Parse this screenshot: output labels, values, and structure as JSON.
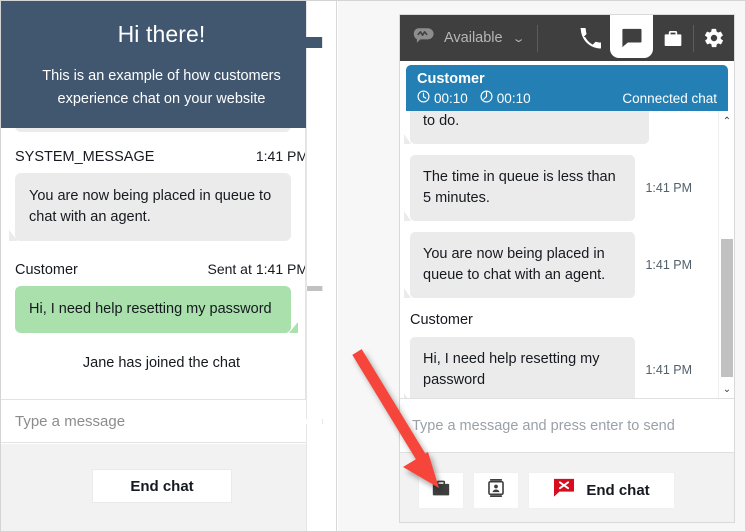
{
  "customer_widget": {
    "header": {
      "title": "Hi there!",
      "subtitle": "This is an example of how customers experience chat on your website"
    },
    "messages": [
      {
        "author": "SYSTEM_MESSAGE",
        "time": "1:41 PM",
        "sent_prefix": "",
        "text": "You are now being placed in queue to chat with an agent.",
        "kind": "system"
      },
      {
        "author": "Customer",
        "time": "1:41 PM",
        "sent_prefix": "Sent at",
        "text": "Hi, I need help resetting my password",
        "kind": "customer"
      }
    ],
    "joined_notice": "Jane has joined the chat",
    "input": {
      "placeholder": "Type a message",
      "value": ""
    },
    "end_chat_label": "End chat",
    "scrollbar": {
      "up": "⌃",
      "down": "⌄"
    },
    "colors": {
      "header_bg": "#41566f",
      "customer_bubble": "#a9e0ab",
      "system_bubble": "#ebebeb"
    }
  },
  "agent_ccp": {
    "topbar": {
      "status_label": "Available",
      "caret": "⌄",
      "icons": [
        "phone-icon",
        "chat-icon",
        "quick-connects-icon",
        "gear-icon"
      ]
    },
    "contact": {
      "name": "Customer",
      "timer_1": "00:10",
      "timer_2": "00:10",
      "state": "Connected chat"
    },
    "chat_log": [
      {
        "author": "",
        "text": "to do.",
        "time": "",
        "clipped": true
      },
      {
        "author": "",
        "text": "The time in queue is less than 5 minutes.",
        "time": "1:41 PM",
        "clipped": false
      },
      {
        "author": "",
        "text": "You are now being placed in queue to chat with an agent.",
        "time": "1:41 PM",
        "clipped": false
      },
      {
        "author": "Customer",
        "text": "Hi, I need help resetting my password",
        "time": "1:41 PM",
        "clipped": false
      }
    ],
    "compose": {
      "placeholder": "Type a message and press enter to send",
      "value": ""
    },
    "actions": {
      "quick_connects_label": "",
      "contact_attributes_label": "",
      "end_chat_label": "End chat"
    },
    "scrollbar": {
      "up": "⌃",
      "down": "⌄"
    },
    "colors": {
      "topbar_bg": "#3f3f3f",
      "contact_bg": "#2480b4",
      "end_chat_badge": "#d50d1f"
    }
  },
  "annotation": {
    "arrow_color": "#f6443a"
  }
}
